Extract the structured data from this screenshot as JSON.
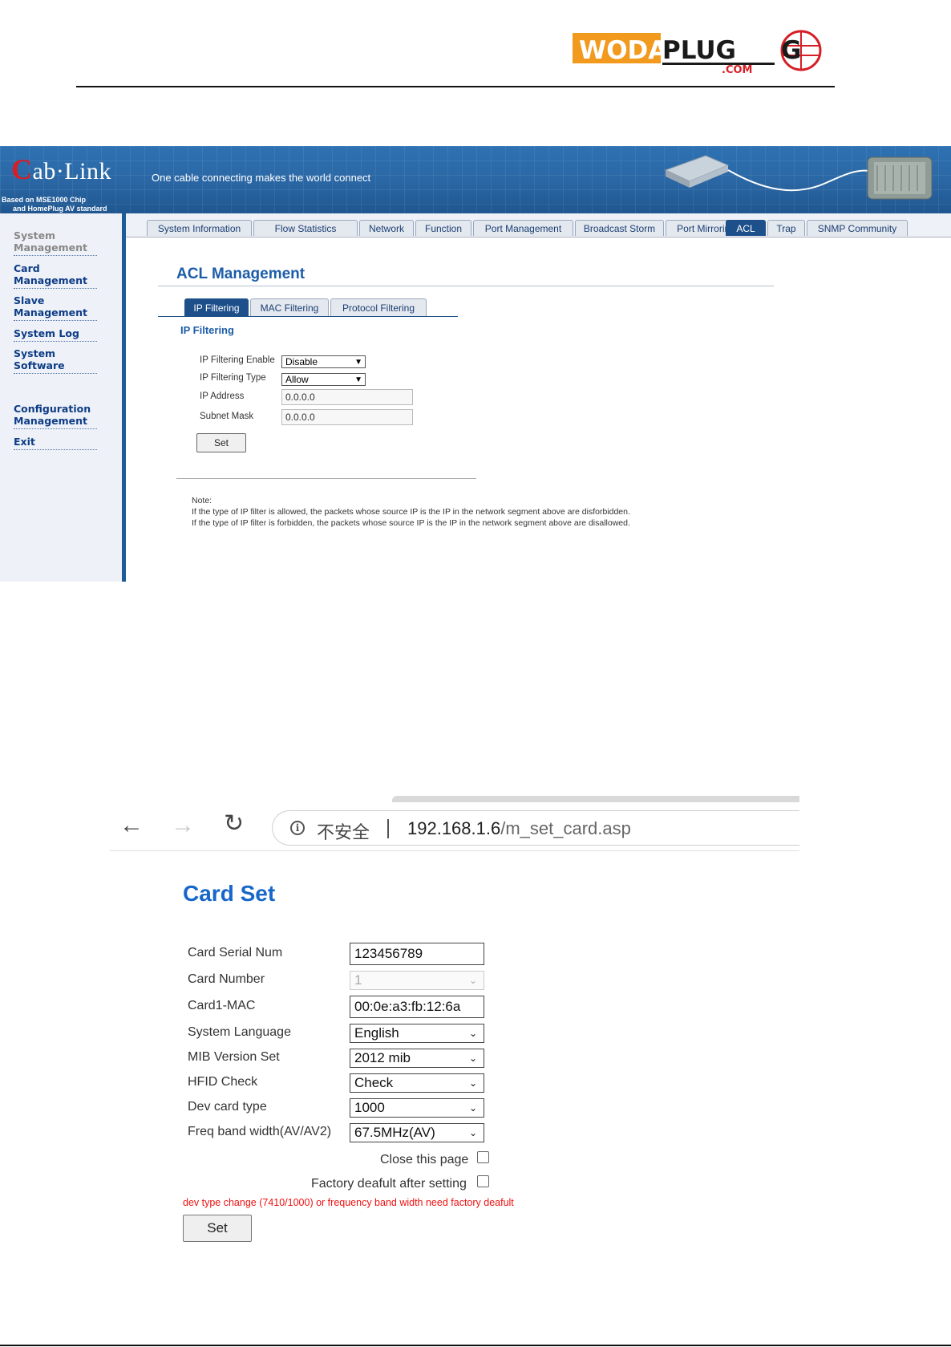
{
  "logo": {
    "text": "wodaplug",
    "subtext": ".com"
  },
  "cablink": {
    "brand_initial": "C",
    "brand_rest": "ab·Link",
    "subline1": "Based on MSE1000 Chip",
    "subline2": "and HomePlug AV standard",
    "slogan": "One cable connecting makes the world connect",
    "sidebar": [
      {
        "label": "System Management"
      },
      {
        "label": "Card Management"
      },
      {
        "label": "Slave Management"
      },
      {
        "label": "System Log"
      },
      {
        "label": "System Software"
      },
      {
        "label": "Configuration Management"
      },
      {
        "label": "Exit"
      }
    ],
    "tabs": [
      {
        "label": "System Information"
      },
      {
        "label": "Flow Statistics"
      },
      {
        "label": "Network"
      },
      {
        "label": "Function"
      },
      {
        "label": "Port Management"
      },
      {
        "label": "Broadcast Storm"
      },
      {
        "label": "Port Mirroring"
      },
      {
        "label": "ACL"
      },
      {
        "label": "Trap"
      },
      {
        "label": "SNMP Community"
      }
    ],
    "active_tab": "ACL",
    "acl_title": "ACL Management",
    "subtabs": [
      {
        "label": "IP Filtering"
      },
      {
        "label": "MAC Filtering"
      },
      {
        "label": "Protocol Filtering"
      }
    ],
    "section_heading": "IP Filtering",
    "form": {
      "enable_label": "IP Filtering Enable",
      "enable_value": "Disable",
      "type_label": "IP Filtering Type",
      "type_value": "Allow",
      "ip_label": "IP Address",
      "ip_value": "0.0.0.0",
      "mask_label": "Subnet Mask",
      "mask_value": "0.0.0.0",
      "set_label": "Set"
    },
    "note": {
      "title": "Note:",
      "line1": "If the type of IP filter is allowed, the packets whose source IP is the IP in the network segment above are disforbidden.",
      "line2": "If the type of IP filter is forbidden, the packets whose source IP is the IP in the network segment above are disallowed."
    }
  },
  "browser": {
    "back_icon": "←",
    "forward_icon": "→",
    "reload_icon": "↻",
    "info_icon": "i",
    "security_text": "不安全",
    "url_host": "192.168.1.6",
    "url_path": "/m_set_card.asp"
  },
  "card_set": {
    "title": "Card Set",
    "serial_label": "Card Serial Num",
    "serial_value": "123456789",
    "number_label": "Card Number",
    "number_value": "1",
    "mac_label": "Card1-MAC",
    "mac_value": "00:0e:a3:fb:12:6a",
    "language_label": "System Language",
    "language_value": "English",
    "mib_label": "MIB Version Set",
    "mib_value": "2012 mib",
    "hfid_label": "HFID Check",
    "hfid_value": "Check",
    "devtype_label": "Dev card type",
    "devtype_value": "1000",
    "freq_label": "Freq band width(AV/AV2)",
    "freq_value": "67.5MHz(AV)",
    "close_label": "Close this page",
    "factory_label": "Factory deafult after setting",
    "warning": "dev type change (7410/1000) or frequency band width need factory deafult",
    "set_label": "Set"
  },
  "colors": {
    "accent": "#1c5ca8",
    "warning": "#e11111",
    "banner": "#2a66a3",
    "logo_orange": "#f29a1e",
    "logo_red": "#d71e26"
  }
}
